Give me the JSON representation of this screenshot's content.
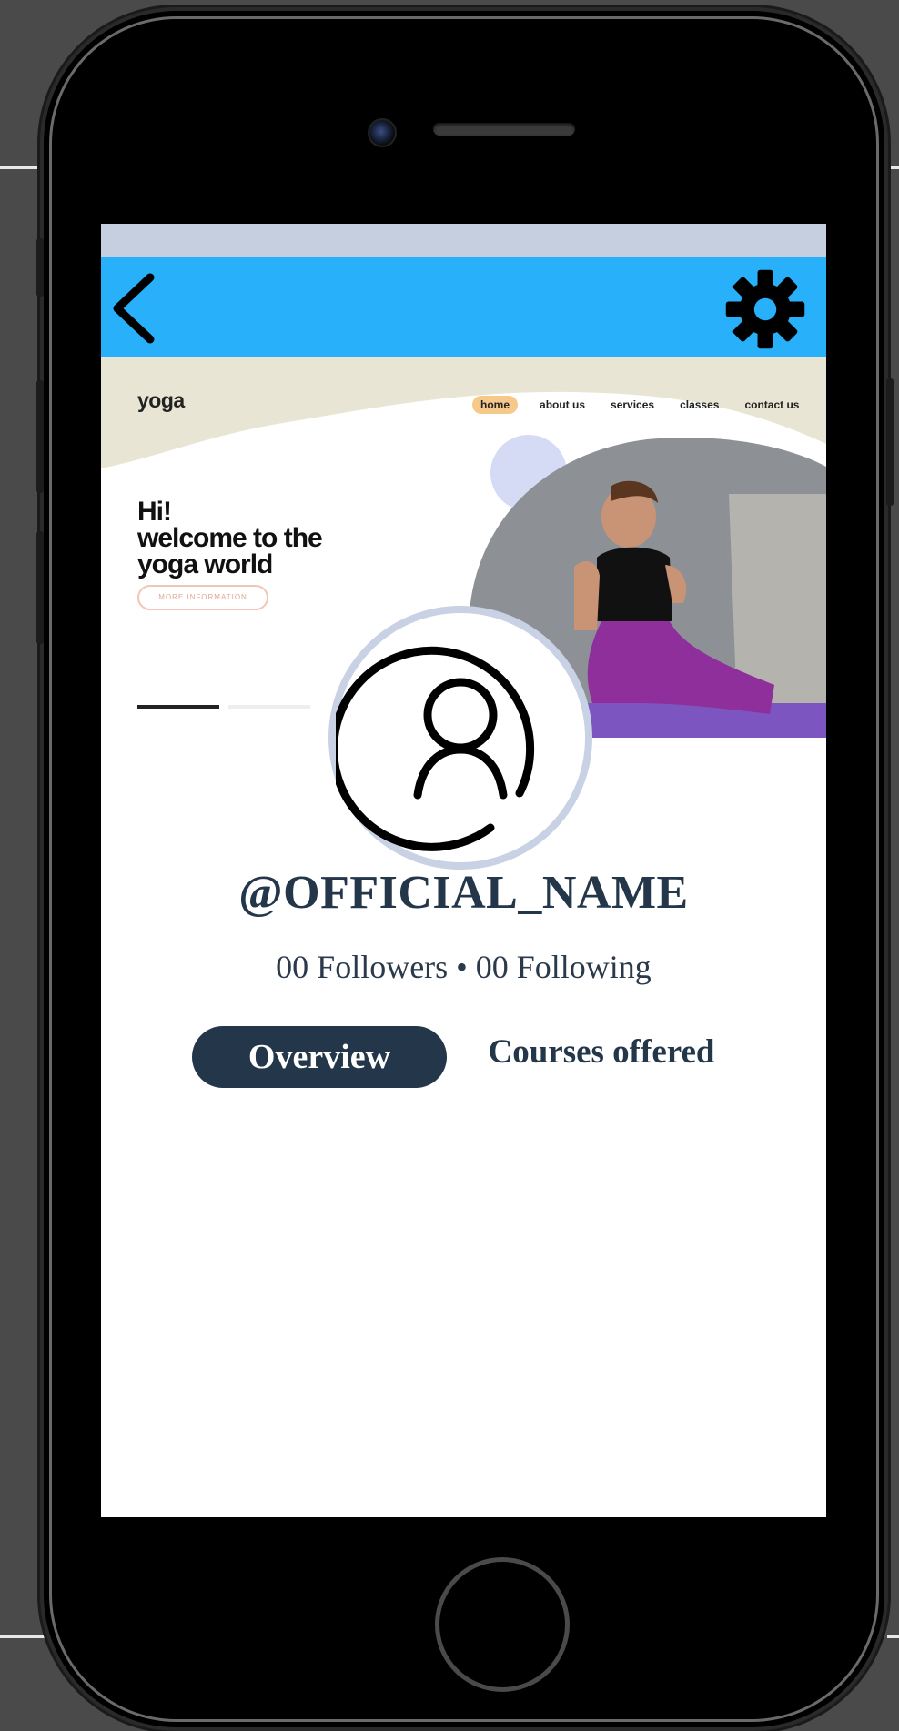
{
  "app_bar": {
    "back_icon": "chevron-left-icon",
    "settings_icon": "gear-icon",
    "color": "#29b0fb"
  },
  "cover": {
    "logo": "yoga",
    "nav": [
      "home",
      "about us",
      "services",
      "classes",
      "contact us"
    ],
    "active_nav": "home",
    "hero_line1": "Hi!",
    "hero_line2": "welcome to the",
    "hero_line3": "yoga world",
    "cta_label": "MORE INFORMATION"
  },
  "profile": {
    "avatar_icon": "user-circle-icon",
    "handle": "@OFFICIAL_NAME",
    "stats": "00 Followers • 00 Following"
  },
  "tabs": {
    "overview": "Overview",
    "courses": "Courses offered",
    "active": "overview",
    "active_color": "#24374a"
  }
}
